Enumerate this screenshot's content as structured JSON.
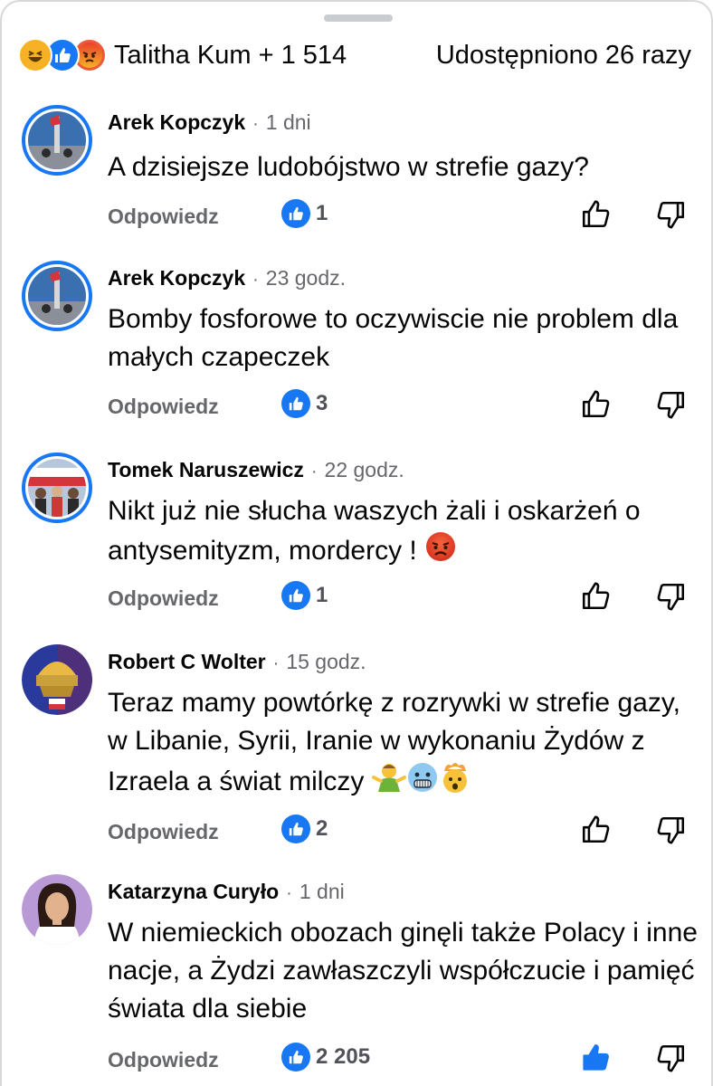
{
  "header": {
    "reactions": [
      "haha-icon",
      "like-icon",
      "angry-icon"
    ],
    "reactions_text": "Talitha Kum + 1 514",
    "shares_text": "Udostępniono 26 razy"
  },
  "labels": {
    "reply": "Odpowiedz"
  },
  "comments": [
    {
      "name": "Arek Kopczyk",
      "time": "1 dni",
      "text": "A dzisiejsze ludobójstwo w strefie gazy?",
      "likes": "1",
      "liked": false
    },
    {
      "name": "Arek Kopczyk",
      "time": "23 godz.",
      "text": "Bomby fosforowe to oczywiscie nie problem dla małych czapeczek",
      "likes": "3",
      "liked": false
    },
    {
      "name": "Tomek Naruszewicz",
      "time": "22 godz.",
      "text": "Nikt już nie słucha waszych żali i oskarżeń o antysemityzm, mordercy !",
      "emojis": [
        "angry-face-emoji"
      ],
      "likes": "1",
      "liked": false
    },
    {
      "name": "Robert C Wolter",
      "time": "15 godz.",
      "text": "Teraz mamy powtórkę z rozrywki w strefie gazy, w Libanie, Syrii, Iranie w wykonaniu Żydów z Izraela a świat milczy",
      "emojis": [
        "person-shrugging-emoji",
        "cold-face-emoji",
        "exploding-head-emoji"
      ],
      "likes": "2",
      "liked": false
    },
    {
      "name": "Katarzyna Curyło",
      "time": "1 dni",
      "text": "W niemieckich obozach ginęli także Polacy i inne nacje, a Żydzi zawłaszczyli współczucie i pamięć świata dla siebie",
      "likes": "2 205",
      "liked": true
    }
  ],
  "colors": {
    "accent": "#1877f2",
    "meta": "#65676b",
    "text": "#050505"
  }
}
